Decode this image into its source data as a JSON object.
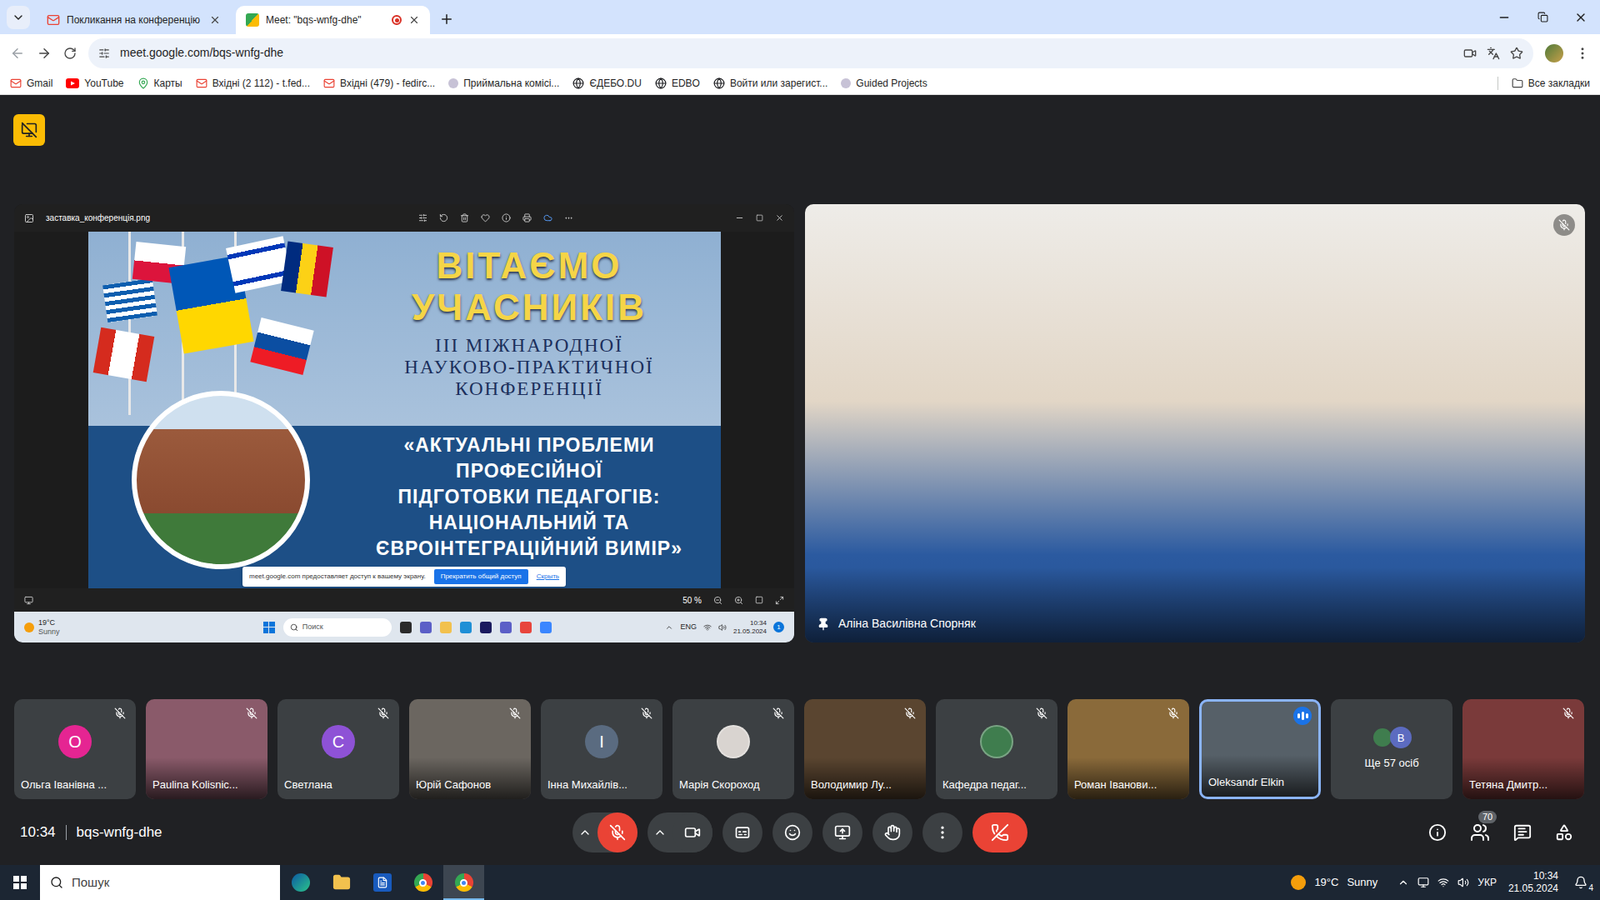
{
  "browser": {
    "tabs": [
      {
        "title": "Покликання на конференцію",
        "kind": "gmail",
        "selected": false,
        "recording": false
      },
      {
        "title": "Meet: \"bqs-wnfg-dhe\"",
        "kind": "meet",
        "selected": true,
        "recording": true
      }
    ],
    "url": "meet.google.com/bqs-wnfg-dhe",
    "bookmarks": [
      {
        "label": "Gmail",
        "kind": "gmail"
      },
      {
        "label": "YouTube",
        "kind": "youtube"
      },
      {
        "label": "Карты",
        "kind": "maps"
      },
      {
        "label": "Вхідні (2 112) - t.fed...",
        "kind": "gmail"
      },
      {
        "label": "Вхідні (479) - fedirc...",
        "kind": "gmail"
      },
      {
        "label": "Приймальна комісі...",
        "kind": "dot"
      },
      {
        "label": "ЄДЕБО.DU",
        "kind": "globe"
      },
      {
        "label": "EDBO",
        "kind": "globe"
      },
      {
        "label": "Войти или зарегист...",
        "kind": "globe"
      },
      {
        "label": "Guided Projects",
        "kind": "dot"
      }
    ],
    "all_bookmarks": "Все закладки"
  },
  "meet": {
    "presentation": {
      "file": "заставка_конференція.png",
      "zoom": "50 %",
      "banner": {
        "greeting": [
          "ВІТАЄМО",
          "УЧАСНИКІВ"
        ],
        "subtitle": [
          "III МІЖНАРОДНОЇ",
          "НАУКОВО-ПРАКТИЧНОЇ",
          "КОНФЕРЕНЦІЇ"
        ],
        "theme": [
          "«АКТУАЛЬНІ ПРОБЛЕМИ",
          "ПРОФЕСІЙНОЇ",
          "ПІДГОТОВКИ ПЕДАГОГІВ:",
          "НАЦІОНАЛЬНИЙ ТА",
          "ЄВРОІНТЕГРАЦІЙНИЙ ВИМІР»"
        ]
      },
      "share_notice": {
        "text": "meet.google.com предоставляет доступ к вашему экрану.",
        "stop": "Прекратить общий доступ",
        "hide": "Скрыть"
      },
      "taskbar": {
        "temp": "19°C",
        "weather": "Sunny",
        "search": "Поиск",
        "apps": [
          {
            "color": "#2b2b2b"
          },
          {
            "color": "#5b5fc7"
          },
          {
            "color": "#f2c14e"
          },
          {
            "color": "#1f8fd6"
          },
          {
            "color": "#1a1a5e"
          },
          {
            "color": "#5b5fc7"
          },
          {
            "color": "#e8453c"
          },
          {
            "color": "#3a86ff"
          }
        ],
        "lang": "ENG",
        "time": "10:34",
        "date": "21.05.2024",
        "notifications": "1"
      }
    },
    "speaker": {
      "name": "Аліна Василівна Спорняк",
      "pinned": true,
      "muted": true
    },
    "participants": [
      {
        "name": "Ольга Іванівна ...",
        "kind": "avatar",
        "initial": "О",
        "color": "#e52592",
        "muted": true,
        "speaking": false
      },
      {
        "name": "Paulina Kolisnic...",
        "kind": "video",
        "initial": "",
        "color": "#8a5a6a",
        "muted": true,
        "speaking": false
      },
      {
        "name": "Светлана",
        "kind": "avatar",
        "initial": "С",
        "color": "#8e52d6",
        "muted": true,
        "speaking": false
      },
      {
        "name": "Юрій Сафонов",
        "kind": "video",
        "initial": "",
        "color": "#6b6660",
        "muted": true,
        "speaking": false
      },
      {
        "name": "Інна Михайлів...",
        "kind": "avatar",
        "initial": "І",
        "color": "#5a6b80",
        "muted": true,
        "speaking": false
      },
      {
        "name": "Марія Скороход",
        "kind": "picture",
        "initial": "",
        "color": "#d9d4d0",
        "muted": true,
        "speaking": false
      },
      {
        "name": "Володимир Лу...",
        "kind": "video",
        "initial": "",
        "color": "#5a4530",
        "muted": true,
        "speaking": false
      },
      {
        "name": "Кафедра педаг...",
        "kind": "picture",
        "initial": "",
        "color": "#3f7d4e",
        "muted": true,
        "speaking": false
      },
      {
        "name": "Роман Іванови...",
        "kind": "video",
        "initial": "",
        "color": "#8a6a3a",
        "muted": true,
        "speaking": false
      },
      {
        "name": "Oleksandr Elkin",
        "kind": "video",
        "initial": "",
        "color": "#566068",
        "muted": false,
        "speaking": true
      },
      {
        "name": "Ще 57 осіб",
        "kind": "more",
        "initial": "B",
        "color": "#5c6bc0",
        "muted": false,
        "speaking": false
      },
      {
        "name": "Тетяна Дмитр...",
        "kind": "video",
        "initial": "",
        "color": "#7a3a3a",
        "muted": true,
        "speaking": false
      }
    ],
    "meeting_time": "10:34",
    "meeting_code": "bqs-wnfg-dhe",
    "mic_on": false,
    "camera_on": true,
    "people_count": "70"
  },
  "taskbar": {
    "search": "Пошук",
    "apps": [
      {
        "kind": "edge",
        "selected": false
      },
      {
        "kind": "explorer",
        "selected": false
      },
      {
        "kind": "word",
        "selected": false
      },
      {
        "kind": "chrome",
        "selected": false
      },
      {
        "kind": "chrome",
        "selected": true
      }
    ],
    "weather_temp": "19°C",
    "weather": "Sunny",
    "lang": "УКР",
    "time": "10:34",
    "date": "21.05.2024",
    "notifications": "4"
  }
}
